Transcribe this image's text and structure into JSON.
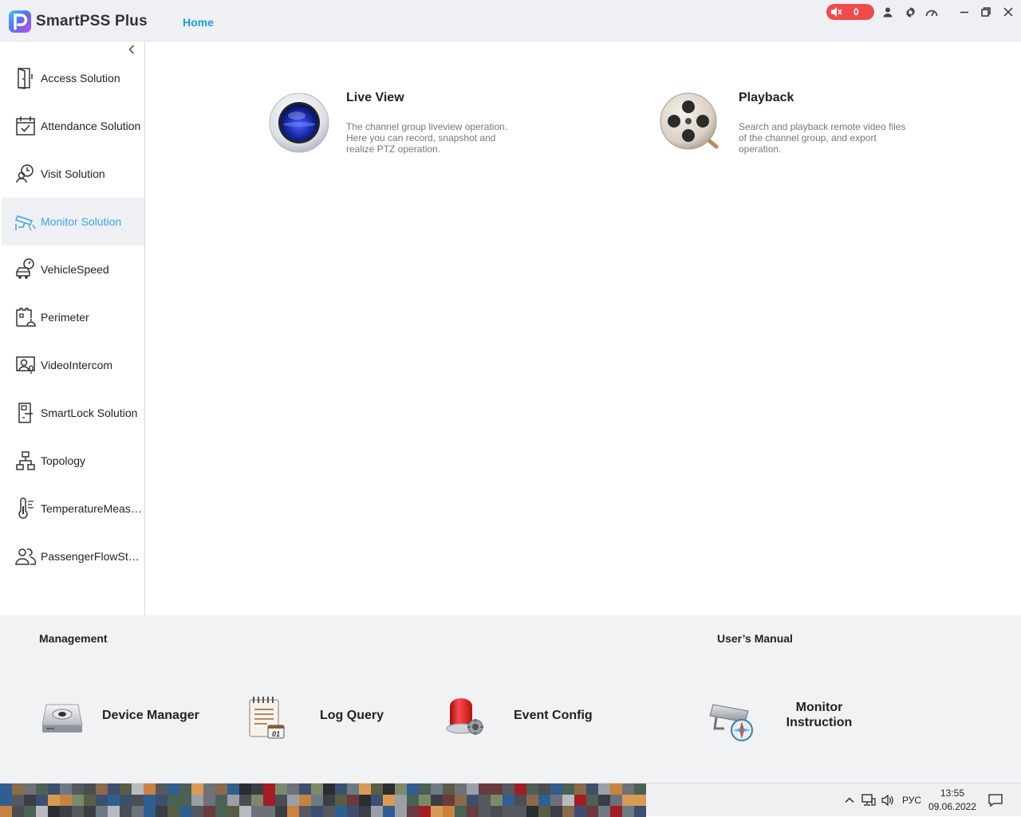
{
  "app": {
    "title": "SmartPSS Plus",
    "home_tab": "Home"
  },
  "titlebar": {
    "alarm_count": "0",
    "accent": "#1e9be6",
    "alarm_color": "#f04a4a"
  },
  "sidebar": {
    "items": [
      {
        "label": "Access Solution",
        "icon": "door-icon"
      },
      {
        "label": "Attendance Solution",
        "icon": "calendar-check-icon"
      },
      {
        "label": "Visit Solution",
        "icon": "visitor-clock-icon"
      },
      {
        "label": "Monitor Solution",
        "icon": "cctv-camera-icon",
        "active": true
      },
      {
        "label": "VehicleSpeed",
        "icon": "car-speedometer-icon"
      },
      {
        "label": "Perimeter",
        "icon": "perimeter-icon"
      },
      {
        "label": "VideoIntercom",
        "icon": "intercom-icon"
      },
      {
        "label": "SmartLock Solution",
        "icon": "smartlock-icon"
      },
      {
        "label": "Topology",
        "icon": "topology-icon"
      },
      {
        "label": "TemperatureMeasurement",
        "icon": "thermometer-icon"
      },
      {
        "label": "PassengerFlowStatistics",
        "icon": "people-icon"
      }
    ]
  },
  "main": {
    "live_view": {
      "title": "Live View",
      "desc": "The channel group liveview operation. Here you can record, snapshot and realize PTZ operation."
    },
    "playback": {
      "title": "Playback",
      "desc": "Search and playback remote video files of the channel group, and export operation."
    }
  },
  "bottom": {
    "management_title": "Management",
    "manual_title": "User’s Manual",
    "tools": [
      {
        "label": "Device Manager",
        "icon": "device-manager-icon"
      },
      {
        "label": "Log Query",
        "icon": "log-query-icon"
      },
      {
        "label": "Event Config",
        "icon": "alarm-light-icon"
      }
    ],
    "manual": {
      "label": "Monitor Instruction",
      "icon": "camera-compass-icon"
    }
  },
  "taskbar": {
    "lang": "РУС",
    "time": "13:55",
    "date": "09.06.2022"
  }
}
